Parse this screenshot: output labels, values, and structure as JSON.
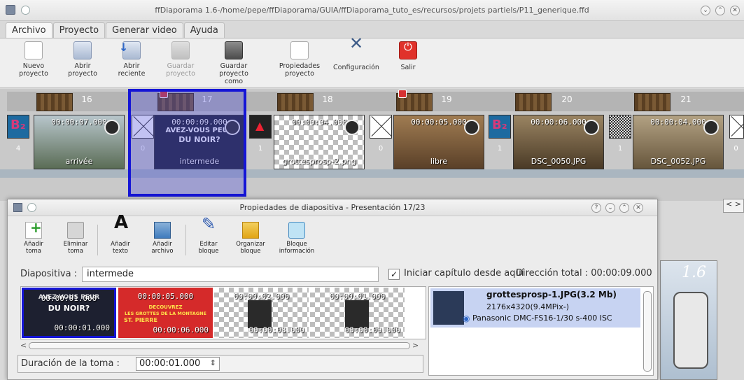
{
  "window": {
    "title": "ffDiaporama 1.6-/home/pepe/ffDiaporama/GUIA/ffDiaporama_tuto_es/recursos/projets partiels/P11_generique.ffd"
  },
  "menu": {
    "tabs": [
      "Archivo",
      "Proyecto",
      "Generar video",
      "Ayuda"
    ]
  },
  "toolbar": {
    "new_line1": "Nuevo",
    "new_line2": "proyecto",
    "open_line1": "Abrir",
    "open_line2": "proyecto",
    "recent_line1": "Abrir",
    "recent_line2": "reciente",
    "save_line1": "Guardar",
    "save_line2": "proyecto",
    "saveas_line1": "Guardar",
    "saveas_line2": "proyecto como",
    "props_line1": "Propiedades",
    "props_line2": "proyecto",
    "config": "Configuración",
    "exit": "Salir"
  },
  "timeline": {
    "slides": [
      {
        "num": "16",
        "time": "00:00:07.000",
        "label": "arrivée",
        "trans_num": "4",
        "trans": "b2"
      },
      {
        "num": "17",
        "time": "00:00:09.000",
        "label": "intermede",
        "trans_num": "0",
        "trans": "cross",
        "text1": "AVEZ-VOUS PEUR",
        "text2": "DU NOIR?"
      },
      {
        "num": "18",
        "time": "00:00:04.000",
        "label": "grottesprosp-2.png",
        "trans_num": "1",
        "trans": "fire"
      },
      {
        "num": "19",
        "time": "00:00:05.000",
        "label": "libre",
        "trans_num": "0",
        "trans": "cross"
      },
      {
        "num": "20",
        "time": "00:00:06.000",
        "label": "DSC_0050.JPG",
        "trans_num": "1",
        "trans": "b2"
      },
      {
        "num": "21",
        "time": "00:00:04.000",
        "label": "DSC_0052.JPG",
        "trans_num": "1",
        "trans": "noise"
      }
    ],
    "last_trans_num": "0"
  },
  "dialog": {
    "title": "Propiedades de diapositiva - Presentación 17/23",
    "tools": {
      "add_line1": "Añadir",
      "add_line2": "toma",
      "del_line1": "Eliminar",
      "del_line2": "toma",
      "text_line1": "Añadir",
      "text_line2": "texto",
      "file_line1": "Añadir",
      "file_line2": "archivo",
      "edit_line1": "Editar",
      "edit_line2": "bloque",
      "org_line1": "Organizar",
      "org_line2": "bloque",
      "info_line1": "Bloque",
      "info_line2": "información"
    },
    "slide_label": "Diapositiva :",
    "slide_name": "intermede",
    "chapter_checked": "✓",
    "chapter_label": "Iniciar capítulo desde aquí",
    "total_duration": "Dirección total : 00:00:09.000",
    "shots": [
      {
        "top": "00:00:01.000",
        "bottom": "00:00:01.000",
        "text1": "AVEZ-VOUS PEUR",
        "text2": "DU NOIR?"
      },
      {
        "top": "00:00:05.000",
        "bottom": "00:00:06.000",
        "text1": "DECOUVREZ",
        "text2": "LES GROTTES DE LA MONTAGNE",
        "text3": "ST. PIERRE"
      },
      {
        "top": "00:00:02.000",
        "bottom": "00:00:08.000"
      },
      {
        "top": "00:00:01.000",
        "bottom": "00:00:09.000"
      }
    ],
    "duration_label": "Duración de la toma :",
    "duration_value": "00:00:01.000",
    "info": {
      "file": "grottesprosp-1.JPG(3.2 Mb)",
      "dimensions": "2176x4320(9.4MPix-)",
      "camera": "Panasonic DMC-FS16-1/30 s-400 ISC"
    }
  },
  "preview": {
    "version": "1.6"
  },
  "colors": {
    "selection": "#1515d6",
    "exit_red": "#e0322b"
  }
}
